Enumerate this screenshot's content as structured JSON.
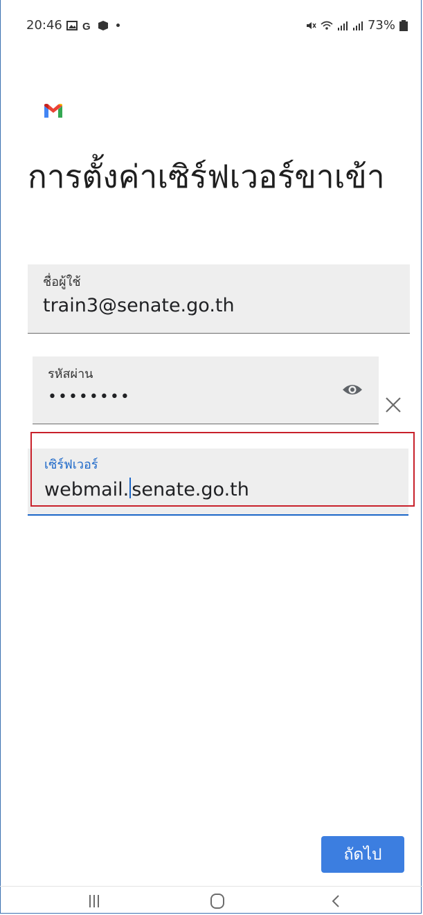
{
  "status_bar": {
    "time": "20:46",
    "left_icons": [
      "gallery-icon",
      "google-icon",
      "lazada-icon"
    ],
    "right_icons": [
      "mute-icon",
      "wifi-icon",
      "signal-icon",
      "signal-icon",
      "battery-icon"
    ],
    "battery": "73%"
  },
  "app": {
    "logo": "gmail-icon"
  },
  "page": {
    "title": "การตั้งค่าเซิร์ฟเวอร์ขาเข้า"
  },
  "form": {
    "username": {
      "label": "ชื่อผู้ใช้",
      "value": "train3@senate.go.th"
    },
    "password": {
      "label": "รหัสผ่าน",
      "value": "••••••••"
    },
    "server": {
      "label": "เซิร์ฟเวอร์",
      "value_before_caret": "webmail.",
      "value_after_caret": "senate.go.th"
    }
  },
  "actions": {
    "next": "ถัดไป"
  },
  "colors": {
    "accent": "#1a66c8",
    "highlight": "#c8202a",
    "button": "#3c7ee0"
  }
}
